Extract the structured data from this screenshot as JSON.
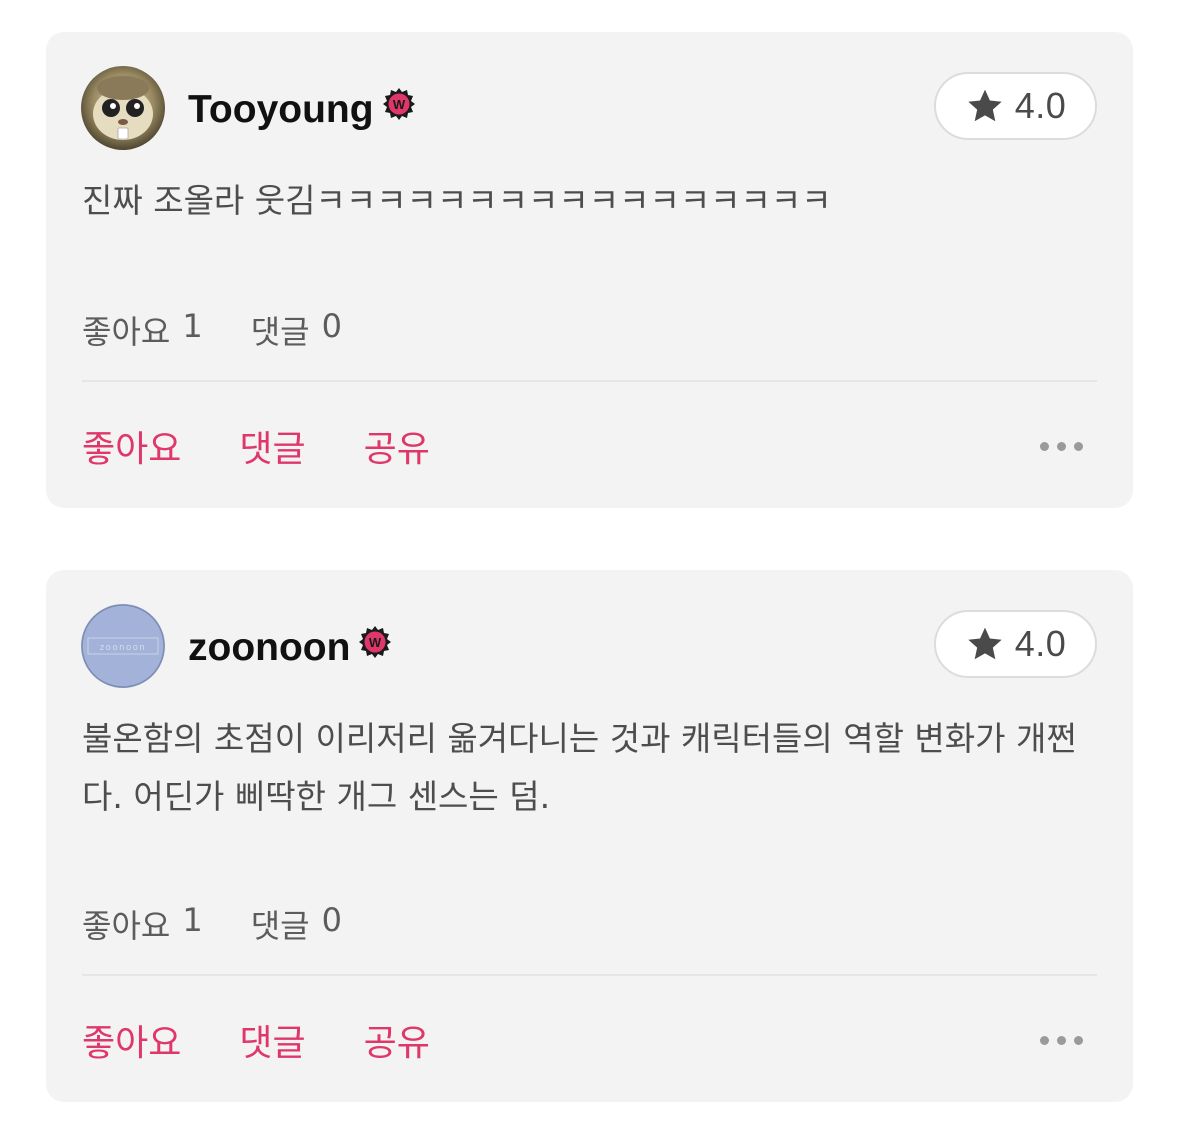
{
  "reviews": [
    {
      "username": "Tooyoung",
      "avatar": "hamster-avatar",
      "rating": "4.0",
      "text": "진짜 조올라 웃김ㅋㅋㅋㅋㅋㅋㅋㅋㅋㅋㅋㅋㅋㅋㅋㅋㅋ",
      "likes_label": "좋아요",
      "likes_count": "1",
      "comments_label": "댓글",
      "comments_count": "0",
      "actions": {
        "like": "좋아요",
        "comment": "댓글",
        "share": "공유"
      }
    },
    {
      "username": "zoonoon",
      "avatar": "zoonoon",
      "rating": "4.0",
      "text": "불온함의 초점이 이리저리 옮겨다니는 것과 캐릭터들의 역할 변화가 개쩐다. 어딘가 삐딱한 개그 센스는 덤.",
      "likes_label": "좋아요",
      "likes_count": "1",
      "comments_label": "댓글",
      "comments_count": "0",
      "actions": {
        "like": "좋아요",
        "comment": "댓글",
        "share": "공유"
      }
    }
  ],
  "colors": {
    "accent": "#e0376b",
    "card_bg": "#f3f3f3",
    "badge": "#e0376b"
  },
  "icons": {
    "rating": "star-icon",
    "badge": "watcha-badge-icon",
    "more": "more-dots-icon"
  }
}
